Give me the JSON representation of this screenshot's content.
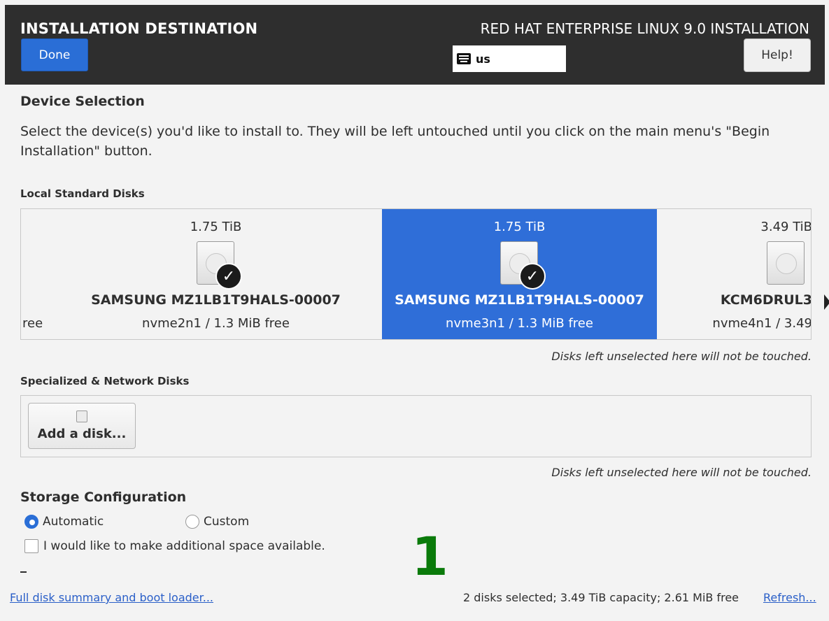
{
  "header": {
    "title": "INSTALLATION DESTINATION",
    "done_label": "Done",
    "product": "RED HAT ENTERPRISE LINUX 9.0 INSTALLATION",
    "keyboard_layout": "us",
    "help_label": "Help!"
  },
  "device_selection": {
    "title": "Device Selection",
    "description": "Select the device(s) you'd like to install to.  They will be left untouched until you click on the main menu's \"Begin Installation\" button."
  },
  "local_disks": {
    "heading": "Local Standard Disks",
    "partial_left_text": "ree",
    "disks": [
      {
        "size": "1.75 TiB",
        "model": "SAMSUNG MZ1LB1T9HALS-00007",
        "info": "nvme2n1   /   1.3 MiB free",
        "selected": true,
        "highlighted": false
      },
      {
        "size": "1.75 TiB",
        "model": "SAMSUNG MZ1LB1T9HALS-00007",
        "info": "nvme3n1   /   1.3 MiB free",
        "selected": true,
        "highlighted": true
      },
      {
        "size": "3.49 TiB",
        "model": "KCM6DRUL3",
        "info": "nvme4n1 / 3.49",
        "selected": false,
        "highlighted": false
      }
    ],
    "note": "Disks left unselected here will not be touched."
  },
  "specialized": {
    "heading": "Specialized & Network Disks",
    "add_disk_label": "Add a disk...",
    "note": "Disks left unselected here will not be touched."
  },
  "storage": {
    "title": "Storage Configuration",
    "automatic_label": "Automatic",
    "custom_label": "Custom",
    "selected": "Automatic",
    "additional_space_label": "I would like to make additional space available."
  },
  "overlay_number": "1",
  "footer": {
    "summary_link": "Full disk summary and boot loader...",
    "status": "2 disks selected; 3.49 TiB capacity; 2.61 MiB free",
    "refresh_link": "Refresh..."
  },
  "colors": {
    "header_bg": "#2e2e2e",
    "accent": "#2a6ed6",
    "selected_disk": "#2f6ed8",
    "link": "#2a5fc8",
    "overlay": "#0a7a0a"
  }
}
